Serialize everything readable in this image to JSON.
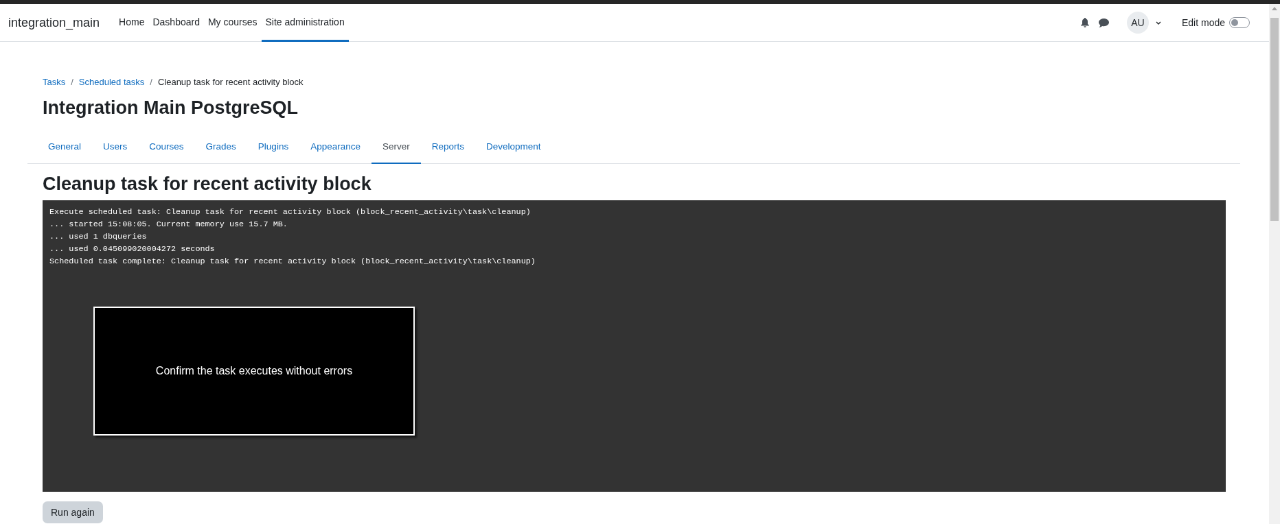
{
  "navbar": {
    "brand": "integration_main",
    "items": [
      {
        "label": "Home",
        "selected": false
      },
      {
        "label": "Dashboard",
        "selected": false
      },
      {
        "label": "My courses",
        "selected": false
      },
      {
        "label": "Site administration",
        "selected": true
      }
    ],
    "avatar": "AU",
    "edit_mode": {
      "label": "Edit mode",
      "on": false
    }
  },
  "breadcrumbs": [
    {
      "label": "Tasks",
      "kind": "link"
    },
    {
      "separator": "/",
      "label": "Scheduled tasks",
      "kind": "link"
    },
    {
      "separator": "/",
      "label": "Cleanup task for recent activity block",
      "kind": "current"
    }
  ],
  "page_title": "Integration Main PostgreSQL",
  "tabs": [
    {
      "label": "General",
      "selected": false
    },
    {
      "label": "Users",
      "selected": false
    },
    {
      "label": "Courses",
      "selected": false
    },
    {
      "label": "Grades",
      "selected": false
    },
    {
      "label": "Plugins",
      "selected": false
    },
    {
      "label": "Appearance",
      "selected": false
    },
    {
      "label": "Server",
      "selected": true
    },
    {
      "label": "Reports",
      "selected": false
    },
    {
      "label": "Development",
      "selected": false
    }
  ],
  "heading": "Cleanup task for recent activity block",
  "console": {
    "lines": [
      "Execute scheduled task: Cleanup task for recent activity block (block_recent_activity\\task\\cleanup)",
      "... started 15:08:05. Current memory use 15.7 MB.",
      "... used 1 dbqueries",
      "... used 0.045099020004272 seconds",
      "Scheduled task complete: Cleanup task for recent activity block (block_recent_activity\\task\\cleanup)"
    ]
  },
  "overlay": {
    "text": "Confirm the task executes without errors"
  },
  "buttons": [
    "Run again"
  ]
}
